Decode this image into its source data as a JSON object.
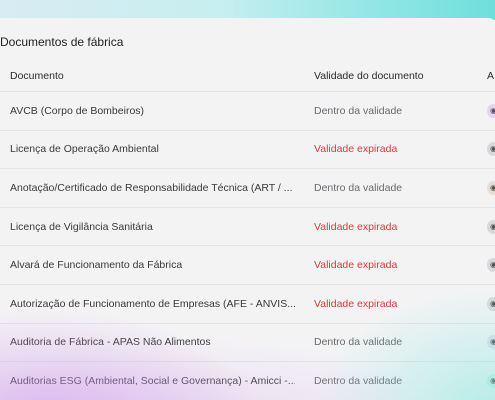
{
  "section": {
    "title": "Documentos de fábrica"
  },
  "table": {
    "columns": [
      "Documento",
      "Validade do documento",
      "A"
    ],
    "rows": [
      {
        "documento": "AVCB (Corpo de Bombeiros)",
        "validade": "Dentro da validade",
        "status": "valid"
      },
      {
        "documento": "Licença de Operação Ambiental",
        "validade": "Validade expirada",
        "status": "expired"
      },
      {
        "documento": "Anotação/Certificado de Responsabilidade Técnica (ART / ...",
        "validade": "Dentro da validade",
        "status": "valid"
      },
      {
        "documento": "Licença de Vigilância Sanitária",
        "validade": "Validade expirada",
        "status": "expired"
      },
      {
        "documento": "Alvará de Funcionamento da Fábrica",
        "validade": "Validade expirada",
        "status": "expired"
      },
      {
        "documento": "Autorização de Funcionamento de Empresas (AFE - ANVIS...",
        "validade": "Validade expirada",
        "status": "expired"
      },
      {
        "documento": "Auditoria de Fábrica - APAS Não Alimentos",
        "validade": "Dentro da validade",
        "status": "valid"
      },
      {
        "documento": "Auditorias ESG (Ambiental, Social e Governança) - Amicci -...",
        "validade": "Dentro da validade",
        "status": "valid"
      }
    ]
  },
  "colors": {
    "expired": "#d93a3a",
    "valid": "#6a6a6e"
  }
}
